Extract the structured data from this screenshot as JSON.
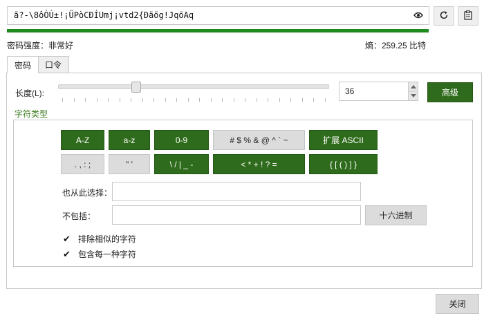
{
  "password": {
    "value": "ã?-\\8ôÓÚ±!¡ÜPòCÐÍUmj¡vtd2{Ðäög!JqöAq",
    "strength_fraction": 1.0,
    "strength_label": "密码强度：非常好",
    "entropy_label": "熵：259.25 比特"
  },
  "tabs": [
    {
      "label": "密码"
    },
    {
      "label": "口令"
    }
  ],
  "length": {
    "label": "长度(L):",
    "value": "36",
    "slider_fraction": 0.28
  },
  "advanced_button": "高级",
  "char_types_title": "字符类型",
  "char_buttons": [
    {
      "label": "A-Z",
      "on": true
    },
    {
      "label": "a-z",
      "on": true
    },
    {
      "label": "0-9",
      "on": true
    },
    {
      "label": "# $ % & @ ^ ` ~",
      "on": false
    },
    {
      "label": "扩展 ASCII",
      "on": true
    },
    {
      "label": ". , : ;",
      "on": false
    },
    {
      "label": "\" '",
      "on": false
    },
    {
      "label": "\\ / | _ -",
      "on": true
    },
    {
      "label": "< * + ! ? =",
      "on": true
    },
    {
      "label": "{ [ ( ) ] }",
      "on": true
    }
  ],
  "also_choose_label": "也从此选择：",
  "also_choose_value": "",
  "exclude_label": "不包括：",
  "exclude_value": "",
  "hex_button": "十六进制",
  "options": [
    {
      "label": "排除相似的字符",
      "checked": true
    },
    {
      "label": "包含每一种字符",
      "checked": true
    }
  ],
  "close_button": "关闭",
  "icons": {
    "eye": "eye-icon",
    "refresh": "refresh-icon",
    "clipboard": "clipboard-icon"
  },
  "colors": {
    "accent": "#2f6b1c",
    "progress": "#1f8a1f"
  }
}
